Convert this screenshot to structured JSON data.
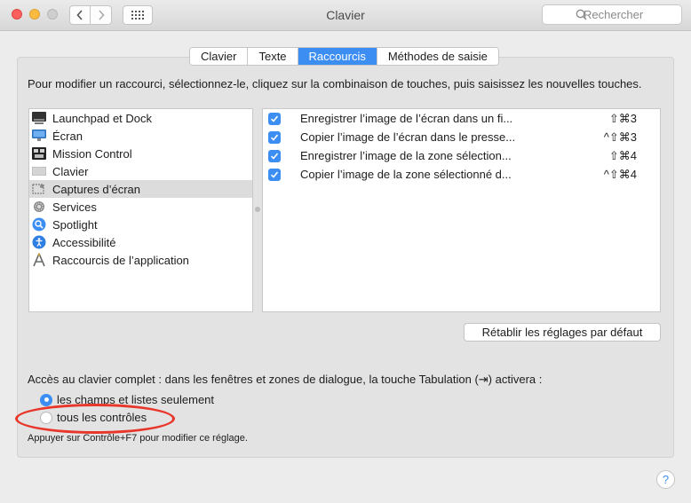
{
  "window": {
    "title": "Clavier",
    "search_placeholder": "Rechercher"
  },
  "tabs": [
    {
      "label": "Clavier",
      "active": false
    },
    {
      "label": "Texte",
      "active": false
    },
    {
      "label": "Raccourcis",
      "active": true
    },
    {
      "label": "Méthodes de saisie",
      "active": false
    }
  ],
  "description": "Pour modifier un raccourci, sélectionnez-le, cliquez sur la combinaison de touches, puis saisissez les nouvelles touches.",
  "categories": [
    {
      "label": "Launchpad et Dock",
      "icon": "launchpad-icon"
    },
    {
      "label": "Écran",
      "icon": "display-icon"
    },
    {
      "label": "Mission Control",
      "icon": "mission-control-icon"
    },
    {
      "label": "Clavier",
      "icon": "keyboard-icon"
    },
    {
      "label": "Captures d’écran",
      "icon": "screenshot-icon",
      "selected": true
    },
    {
      "label": "Services",
      "icon": "gear-icon"
    },
    {
      "label": "Spotlight",
      "icon": "spotlight-icon"
    },
    {
      "label": "Accessibilité",
      "icon": "accessibility-icon"
    },
    {
      "label": "Raccourcis de l’application",
      "icon": "app-shortcuts-icon"
    }
  ],
  "shortcuts": [
    {
      "label": "Enregistrer l’image de l’écran dans un fi...",
      "key": "⇧⌘3",
      "checked": true
    },
    {
      "label": "Copier l’image de l’écran dans le presse...",
      "key": "^⇧⌘3",
      "checked": true
    },
    {
      "label": "Enregistrer l’image de la zone sélection...",
      "key": "⇧⌘4",
      "checked": true
    },
    {
      "label": "Copier l’image de la zone sélectionné d...",
      "key": "^⇧⌘4",
      "checked": true
    }
  ],
  "restore_button": "Rétablir les réglages par défaut",
  "full_keyboard_access": {
    "text": "Accès au clavier complet : dans les fenêtres et zones de dialogue, la touche Tabulation (⇥) activera :",
    "options": [
      {
        "label": "les champs et listes seulement",
        "selected": true
      },
      {
        "label": "tous les contrôles",
        "selected": false
      }
    ],
    "hint": "Appuyer sur Contrôle+F7 pour modifier ce réglage."
  },
  "help_button": "?",
  "colors": {
    "accent": "#3c8ef3",
    "highlight_annotation": "#e8362a"
  }
}
